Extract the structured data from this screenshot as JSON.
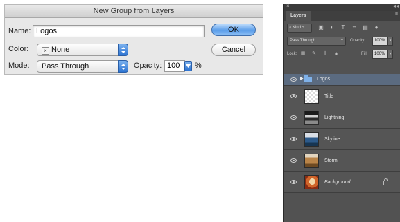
{
  "dialog": {
    "title": "New Group from Layers",
    "name_label": "Name:",
    "name_value": "Logos",
    "color_label": "Color:",
    "color_value": "None",
    "mode_label": "Mode:",
    "mode_value": "Pass Through",
    "opacity_label": "Opacity:",
    "opacity_value": "100",
    "opacity_unit": "%",
    "ok_label": "OK",
    "cancel_label": "Cancel"
  },
  "panel": {
    "tab_label": "Layers",
    "kind_label": "Kind",
    "blend_mode": "Pass Through",
    "opacity_label": "Opacity:",
    "opacity_value": "100%",
    "lock_label": "Lock:",
    "fill_label": "Fill:",
    "fill_value": "100%",
    "layers": [
      {
        "name": "Logos",
        "type": "group"
      },
      {
        "name": "Title",
        "type": "layer"
      },
      {
        "name": "Lightning",
        "type": "layer"
      },
      {
        "name": "Skyline",
        "type": "layer"
      },
      {
        "name": "Storm",
        "type": "layer"
      },
      {
        "name": "Background",
        "type": "background",
        "locked": true
      }
    ]
  },
  "colors": {
    "button_blue": "#5a9de9",
    "panel_bg": "#525252",
    "group_highlight": "#5b6b80"
  }
}
